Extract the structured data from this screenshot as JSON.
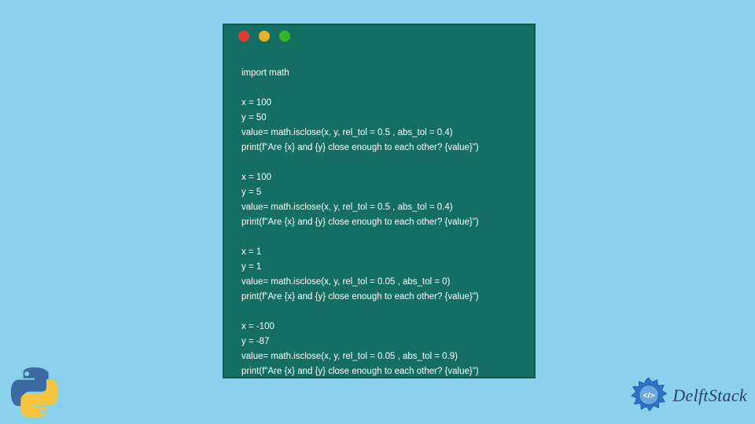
{
  "code_lines": [
    "import math",
    "",
    "x = 100",
    "y = 50",
    "value= math.isclose(x, y, rel_tol = 0.5 , abs_tol = 0.4)",
    "print(f\"Are {x} and {y} close enough to each other? {value}\")",
    "",
    "x = 100",
    "y = 5",
    "value= math.isclose(x, y, rel_tol = 0.5 , abs_tol = 0.4)",
    "print(f\"Are {x} and {y} close enough to each other? {value}\")",
    "",
    "x = 1",
    "y = 1",
    "value= math.isclose(x, y, rel_tol = 0.05 , abs_tol = 0)",
    "print(f\"Are {x} and {y} close enough to each other? {value}\")",
    "",
    "x = -100",
    "y = -87",
    "value= math.isclose(x, y, rel_tol = 0.05 , abs_tol = 0.9)",
    "print(f\"Are {x} and {y} close enough to each other? {value}\")"
  ],
  "brand_text": "DelftStack",
  "colors": {
    "bg": "#89d1ed",
    "window": "#156e62",
    "code_fg": "#ffffff",
    "delft_text": "#2c406b",
    "delft_icon": "#1f5fb0",
    "python_blue": "#3b6aa0",
    "python_yellow": "#f5c542"
  }
}
